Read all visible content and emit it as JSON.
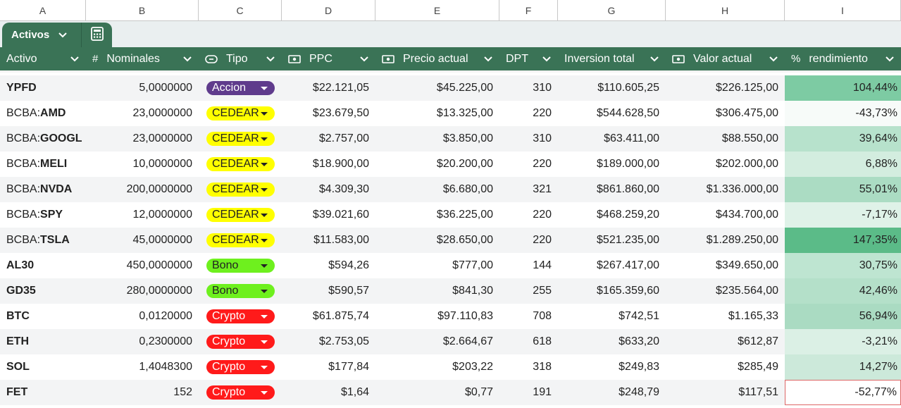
{
  "column_letters": [
    "A",
    "B",
    "C",
    "D",
    "E",
    "F",
    "G",
    "H",
    "I"
  ],
  "table": {
    "name": "Activos"
  },
  "headers": {
    "activo": "Activo",
    "nominales": "Nominales",
    "tipo": "Tipo",
    "ppc": "PPC",
    "precio_actual": "Precio actual",
    "dpt": "DPT",
    "inversion_total": "Inversion total",
    "valor_actual": "Valor actual",
    "rendimiento": "rendimiento"
  },
  "header_icons": {
    "nominales": "#",
    "rendimiento": "%"
  },
  "type_styles": {
    "Accion": {
      "bg": "#5f3b8c",
      "fg": "#ffffff"
    },
    "CEDEAR": {
      "bg": "#ffff00",
      "fg": "#222222"
    },
    "Bono": {
      "bg": "#6ef01e",
      "fg": "#222222"
    },
    "Crypto": {
      "bg": "#ff1a1a",
      "fg": "#ffffff"
    }
  },
  "rows": [
    {
      "prefix": "",
      "ticker": "YPFD",
      "nominales": "5,0000000",
      "tipo": "Accion",
      "ppc": "$22.121,05",
      "precio_actual": "$45.225,00",
      "dpt": "310",
      "inversion_total": "$110.605,25",
      "valor_actual": "$226.125,00",
      "rendimiento": "104,44%",
      "heat": "#7dcba3"
    },
    {
      "prefix": "BCBA:",
      "ticker": "AMD",
      "nominales": "23,0000000",
      "tipo": "CEDEAR",
      "ppc": "$23.679,50",
      "precio_actual": "$13.325,00",
      "dpt": "220",
      "inversion_total": "$544.628,50",
      "valor_actual": "$306.475,00",
      "rendimiento": "-43,73%",
      "heat": "#f7fbf9"
    },
    {
      "prefix": "BCBA:",
      "ticker": "GOOGL",
      "nominales": "23,0000000",
      "tipo": "CEDEAR",
      "ppc": "$2.757,00",
      "precio_actual": "$3.850,00",
      "dpt": "310",
      "inversion_total": "$63.411,00",
      "valor_actual": "$88.550,00",
      "rendimiento": "39,64%",
      "heat": "#b7e2cc"
    },
    {
      "prefix": "BCBA:",
      "ticker": "MELI",
      "nominales": "10,0000000",
      "tipo": "CEDEAR",
      "ppc": "$18.900,00",
      "precio_actual": "$20.200,00",
      "dpt": "220",
      "inversion_total": "$189.000,00",
      "valor_actual": "$202.000,00",
      "rendimiento": "6,88%",
      "heat": "#d3eddf"
    },
    {
      "prefix": "BCBA:",
      "ticker": "NVDA",
      "nominales": "200,0000000",
      "tipo": "CEDEAR",
      "ppc": "$4.309,30",
      "precio_actual": "$6.680,00",
      "dpt": "321",
      "inversion_total": "$861.860,00",
      "valor_actual": "$1.336.000,00",
      "rendimiento": "55,01%",
      "heat": "#abdcc3"
    },
    {
      "prefix": "BCBA:",
      "ticker": "SPY",
      "nominales": "12,0000000",
      "tipo": "CEDEAR",
      "ppc": "$39.021,60",
      "precio_actual": "$36.225,00",
      "dpt": "220",
      "inversion_total": "$468.259,20",
      "valor_actual": "$434.700,00",
      "rendimiento": "-7,17%",
      "heat": "#dff2e8"
    },
    {
      "prefix": "BCBA:",
      "ticker": "TSLA",
      "nominales": "45,0000000",
      "tipo": "CEDEAR",
      "ppc": "$11.583,00",
      "precio_actual": "$28.650,00",
      "dpt": "220",
      "inversion_total": "$521.235,00",
      "valor_actual": "$1.289.250,00",
      "rendimiento": "147,35%",
      "heat": "#5bbb88"
    },
    {
      "prefix": "",
      "ticker": "AL30",
      "nominales": "450,0000000",
      "tipo": "Bono",
      "ppc": "$594,26",
      "precio_actual": "$777,00",
      "dpt": "144",
      "inversion_total": "$267.417,00",
      "valor_actual": "$349.650,00",
      "rendimiento": "30,75%",
      "heat": "#bee5d1"
    },
    {
      "prefix": "",
      "ticker": "GD35",
      "nominales": "280,0000000",
      "tipo": "Bono",
      "ppc": "$590,57",
      "precio_actual": "$841,30",
      "dpt": "255",
      "inversion_total": "$165.359,60",
      "valor_actual": "$235.564,00",
      "rendimiento": "42,46%",
      "heat": "#b4e0c9"
    },
    {
      "prefix": "",
      "ticker": "BTC",
      "nominales": "0,0120000",
      "tipo": "Crypto",
      "ppc": "$61.875,74",
      "precio_actual": "$97.110,83",
      "dpt": "708",
      "inversion_total": "$742,51",
      "valor_actual": "$1.165,33",
      "rendimiento": "56,94%",
      "heat": "#aadbc2"
    },
    {
      "prefix": "",
      "ticker": "ETH",
      "nominales": "0,2300000",
      "tipo": "Crypto",
      "ppc": "$2.753,05",
      "precio_actual": "$2.664,67",
      "dpt": "618",
      "inversion_total": "$633,20",
      "valor_actual": "$612,87",
      "rendimiento": "-3,21%",
      "heat": "#dbf0e5"
    },
    {
      "prefix": "",
      "ticker": "SOL",
      "nominales": "1,4048300",
      "tipo": "Crypto",
      "ppc": "$177,84",
      "precio_actual": "$203,22",
      "dpt": "318",
      "inversion_total": "$249,83",
      "valor_actual": "$285,49",
      "rendimiento": "14,27%",
      "heat": "#cce9da"
    },
    {
      "prefix": "",
      "ticker": "FET",
      "nominales": "152",
      "tipo": "Crypto",
      "ppc": "$1,64",
      "precio_actual": "$0,77",
      "dpt": "191",
      "inversion_total": "$248,79",
      "valor_actual": "$117,51",
      "rendimiento": "-52,77%",
      "heat": "#ffffff"
    }
  ]
}
